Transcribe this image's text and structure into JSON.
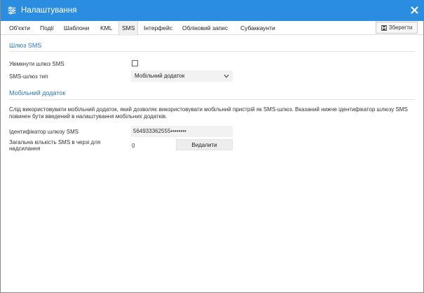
{
  "window": {
    "title": "Налаштування",
    "title_icon": "settings-sliders-icon",
    "close_icon": "close-icon",
    "accent_color": "#2b8de0"
  },
  "tabs": [
    {
      "label": "Об'єкти"
    },
    {
      "label": "Події"
    },
    {
      "label": "Шаблони"
    },
    {
      "label": "KML"
    },
    {
      "label": "SMS",
      "active": true
    },
    {
      "label": "Інтерфейс"
    },
    {
      "label": "Обліковий запис"
    },
    {
      "label": "Субаккаунти"
    }
  ],
  "toolbar": {
    "save_label": "Зберегти",
    "save_icon": "floppy-disk-icon"
  },
  "gateway_section": {
    "title": "Шлюз SMS",
    "enable_label": "Увімкнути шлюз SMS",
    "enable_checked": false,
    "type_label": "SMS-шлюз тип",
    "type_value": "Мобільний додаток"
  },
  "mobile_section": {
    "title": "Мобільний додаток",
    "description": "Слід використовувати мобільний додаток, який дозволяє використовувати мобільний пристрій як SMS-шлюз. Вказаний нижче ідентифікатор шлюзу SMS повинен бути введений в налаштування мобільних додатків.",
    "id_label": "Ідентифікатор шлюзу SMS",
    "id_value": "564933362555••••••••",
    "queue_label": "Загальна кількість SMS в черзі для надсилання",
    "queue_count": "0",
    "delete_label": "Видалити"
  }
}
